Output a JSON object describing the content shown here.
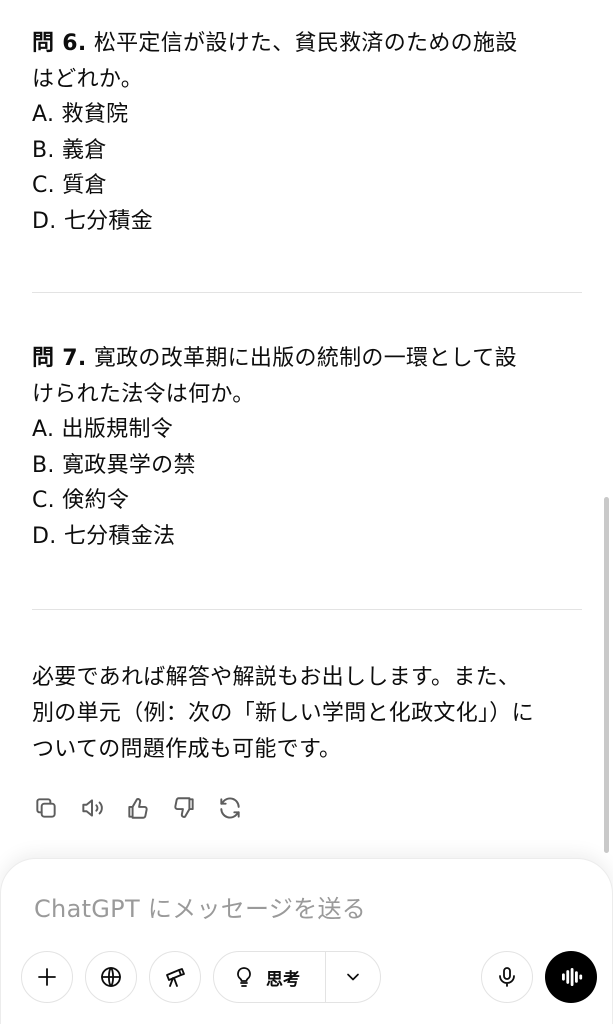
{
  "questions": [
    {
      "number": "問 6.",
      "line1": "松平定信が設けた、貧民救済のための施設",
      "line2": "はどれか。",
      "options": [
        "A. 救貧院",
        "B. 義倉",
        "C. 質倉",
        "D. 七分積金"
      ]
    },
    {
      "number": "問 7.",
      "line1": "寛政の改革期に出版の統制の一環として設",
      "line2": "けられた法令は何か。",
      "options": [
        "A. 出版規制令",
        "B. 寛政異学の禁",
        "C. 倹約令",
        "D. 七分積金法"
      ]
    }
  ],
  "closing": {
    "line1": "必要であれば解答や解説もお出しします。また、",
    "line2": "別の単元（例：次の「新しい学問と化政文化」）に",
    "line3": "ついての問題作成も可能です。"
  },
  "composer": {
    "placeholder": "ChatGPT にメッセージを送る",
    "think_label": "思考"
  },
  "icons": {
    "copy": "copy-icon",
    "read_aloud": "speaker-icon",
    "like": "thumbs-up-icon",
    "dislike": "thumbs-down-icon",
    "regenerate": "refresh-icon",
    "attach": "plus-icon",
    "search": "globe-icon",
    "tools": "telescope-icon",
    "think": "lightbulb-icon",
    "mic": "microphone-icon",
    "voice": "voice-waveform-icon"
  }
}
